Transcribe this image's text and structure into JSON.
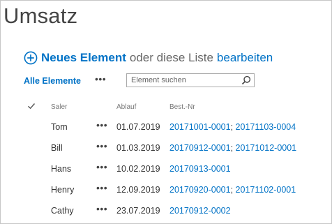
{
  "page": {
    "title": "Umsatz"
  },
  "new_item": {
    "link_label": "Neues Element",
    "or_text": "oder diese Liste",
    "edit_label": "bearbeiten"
  },
  "view_bar": {
    "all_items_label": "Alle Elemente",
    "ellipsis": "•••"
  },
  "search": {
    "placeholder": "Element suchen"
  },
  "list": {
    "columns": {
      "saler": "Saler",
      "ablauf": "Ablauf",
      "bestnr": "Best.-Nr"
    },
    "rows": [
      {
        "saler": "Tom",
        "ellipsis": "•••",
        "ablauf": "01.07.2019",
        "orders": [
          "20171001-0001",
          "20171103-0004"
        ]
      },
      {
        "saler": "Bill",
        "ellipsis": "•••",
        "ablauf": "01.03.2019",
        "orders": [
          "20170912-0001",
          "20171012-0001"
        ]
      },
      {
        "saler": "Hans",
        "ellipsis": "•••",
        "ablauf": "10.02.2019",
        "orders": [
          "20170913-0001"
        ]
      },
      {
        "saler": "Henry",
        "ellipsis": "•••",
        "ablauf": "12.09.2019",
        "orders": [
          "20170920-0001",
          "20171102-0001"
        ]
      },
      {
        "saler": "Cathy",
        "ellipsis": "•••",
        "ablauf": "23.07.2019",
        "orders": [
          "20170912-0002"
        ]
      }
    ]
  },
  "colors": {
    "link": "#0072c6",
    "text": "#333333",
    "muted": "#777777",
    "border": "#c6c6c6"
  },
  "icons": {
    "new_item": "plus-circle-icon",
    "search": "magnifier-icon",
    "select_all": "checkmark-icon"
  }
}
